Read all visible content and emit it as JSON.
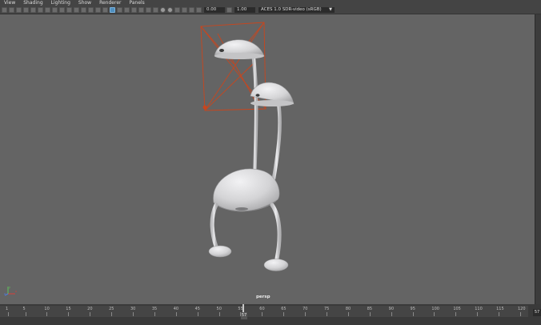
{
  "menubar": {
    "items": [
      {
        "label": "View"
      },
      {
        "label": "Shading"
      },
      {
        "label": "Lighting"
      },
      {
        "label": "Show"
      },
      {
        "label": "Renderer"
      },
      {
        "label": "Panels"
      }
    ]
  },
  "toolbar": {
    "near_clip_value": "0.00",
    "far_clip_value": "1.00",
    "color_management": "ACES 1.0 SDR-video (sRGB)"
  },
  "viewport": {
    "camera_label": "persp",
    "axis_labels": [
      "x",
      "y",
      "z"
    ]
  },
  "timeline": {
    "ticks": [
      "1",
      "5",
      "10",
      "15",
      "20",
      "25",
      "30",
      "35",
      "40",
      "45",
      "50",
      "55",
      "60",
      "65",
      "70",
      "75",
      "80",
      "85",
      "90",
      "95",
      "100",
      "105",
      "110",
      "115",
      "120"
    ],
    "current_frame": "57",
    "end_frame": "57"
  },
  "colors": {
    "selection_wireframe": "#c8461e",
    "model_fill": "#d6d6d8",
    "active_tool": "#4f8fbf"
  }
}
